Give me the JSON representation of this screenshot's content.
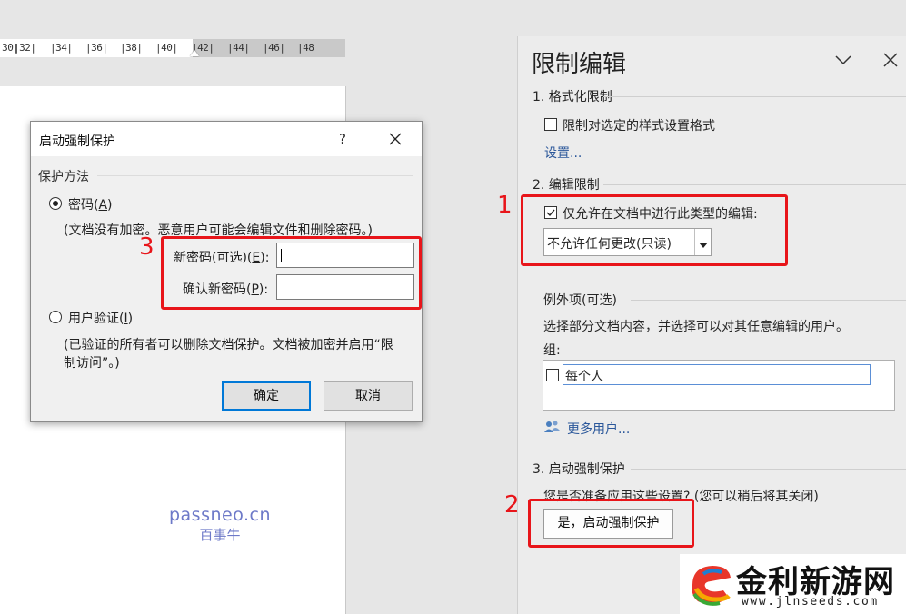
{
  "ruler": {
    "ticks": [
      "|30|",
      "|32|",
      "|34|",
      "|36|",
      "|38|",
      "|40|",
      "|42|",
      "|44|",
      "|46|",
      "|48"
    ]
  },
  "watermark": {
    "line1": "passneo.cn",
    "line2": "百事牛"
  },
  "dialog": {
    "title": "启动强制保护",
    "help": "?",
    "section_label": "保护方法",
    "password_radio": {
      "label": "密码(",
      "key": "A",
      "suffix": ")",
      "checked": true
    },
    "password_note": "(文档没有加密。恶意用户可能会编辑文件和删除密码。)",
    "new_password": {
      "label": "新密码(可选)(",
      "key": "E",
      "suffix": "):",
      "value": ""
    },
    "confirm_password": {
      "label": "确认新密码(",
      "key": "P",
      "suffix": "):",
      "value": ""
    },
    "user_auth_radio": {
      "label": "用户验证(",
      "key": "I",
      "suffix": ")",
      "checked": false
    },
    "user_auth_note_line1": "(已验证的所有者可以删除文档保护。文档被加密并启用“限",
    "user_auth_note_line2": "制访问”。)",
    "ok_label": "确定",
    "cancel_label": "取消"
  },
  "pane": {
    "title": "限制编辑",
    "section1": {
      "heading": "1. 格式化限制",
      "checkbox_label": "限制对选定的样式设置格式",
      "checked": false,
      "settings_link": "设置..."
    },
    "section2": {
      "heading": "2. 编辑限制",
      "checkbox_label": "仅允许在文档中进行此类型的编辑:",
      "checked": true,
      "dropdown_value": "不允许任何更改(只读)",
      "exceptions_heading": "例外项(可选)",
      "exceptions_desc": "选择部分文档内容，并选择可以对其任意编辑的用户。",
      "groups_label": "组:",
      "groups": [
        {
          "name": "每个人",
          "checked": false
        }
      ],
      "more_users_link": "更多用户..."
    },
    "section3": {
      "heading": "3. 启动强制保护",
      "question": "您是否准备应用这些设置? (您可以稍后将其关闭)",
      "start_button": "是，启动强制保护"
    }
  },
  "annotations": {
    "n1": "1",
    "n2": "2",
    "n3": "3",
    "color": "#e8151a"
  },
  "logo": {
    "name": "金利新游网",
    "url": "www.jlnseeds.com"
  },
  "colors": {
    "accent": "#0078d7",
    "link": "#2b579a",
    "annotation": "#e8151a",
    "watermark": "#6d79c8"
  }
}
